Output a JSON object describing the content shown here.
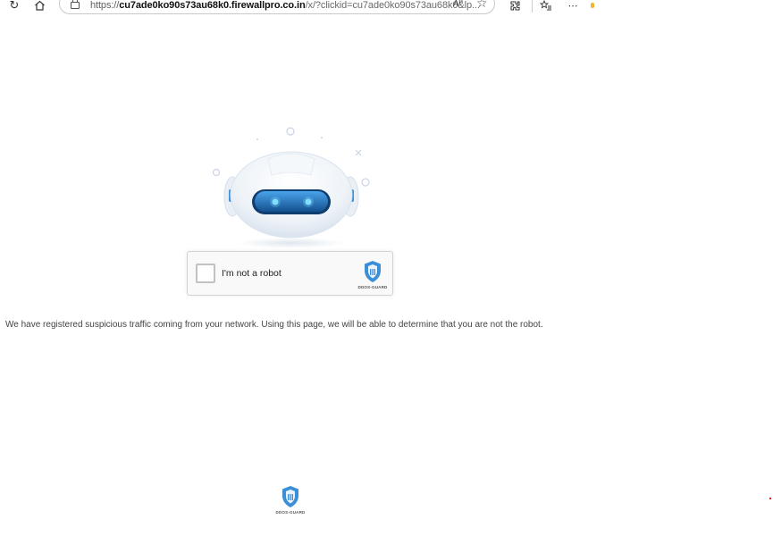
{
  "browser": {
    "url_scheme": "https://",
    "url_domain": "cu7ade0ko90s73au68k0.firewallpro.co.in",
    "url_rest": "/x/?clickid=cu7ade0ko90s73au68k0&lp...",
    "read_aloud_label": "Aᴾ",
    "icons": [
      "refresh-icon",
      "home-icon",
      "lock-icon",
      "read-aloud-icon",
      "favorite-star-icon",
      "extensions-icon",
      "favorites-icon",
      "more-icon"
    ]
  },
  "captcha": {
    "label": "I'm not a robot",
    "brand": "DDOS-GUARD"
  },
  "message": "We have registered suspicious traffic coming from your network. Using this page, we will be able to determine that you are not the robot.",
  "footer": {
    "brand": "DDOS-GUARD"
  },
  "colors": {
    "shield": "#3a8fd8",
    "robot_visor": "#1f6fb8",
    "robot_eye": "#5fd3ff"
  }
}
